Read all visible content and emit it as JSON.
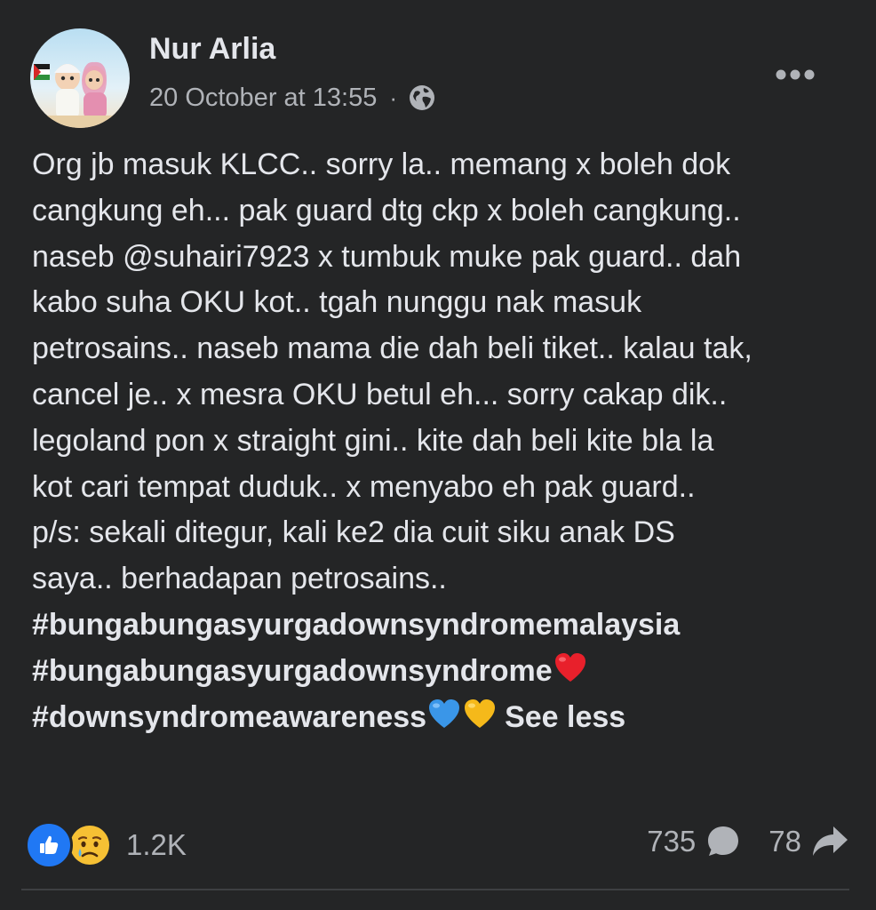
{
  "post": {
    "author": "Nur Arlia",
    "timestamp": "20 October at 13:55",
    "separator": "·",
    "audience_icon": "globe-icon",
    "more_icon": "more-options-icon",
    "body_lines": [
      "Org jb masuk KLCC.. sorry la.. memang x boleh dok",
      "cangkung eh... pak guard dtg ckp x boleh cangkung..",
      "naseb @suhairi7923 x tumbuk muke pak guard.. dah",
      "kabo suha OKU kot.. tgah nunggu nak masuk",
      "petrosains.. naseb mama die dah beli tiket.. kalau tak,",
      "cancel je.. x mesra OKU betul eh... sorry cakap dik..",
      "legoland pon x straight gini.. kite dah beli kite bla la",
      "kot cari tempat duduk.. x menyabo eh pak guard..",
      "p/s: sekali ditegur, kali ke2 dia cuit siku anak DS",
      "saya.. berhadapan petrosains.."
    ],
    "hashtags": [
      "#bungabungasyurgadownsyndromemalaysia",
      "#bungabungasyurgadownsyndrome",
      "#downsyndromeawareness"
    ],
    "see_less": "See less"
  },
  "footer": {
    "reactions": [
      "like",
      "sad"
    ],
    "reaction_count": "1.2K",
    "comments_count": "735",
    "shares_count": "78"
  },
  "colors": {
    "background": "#242526",
    "primary_text": "#e4e6eb",
    "secondary_text": "#b0b3b8",
    "like_blue": "#2078f4",
    "divider": "#3e4042"
  }
}
